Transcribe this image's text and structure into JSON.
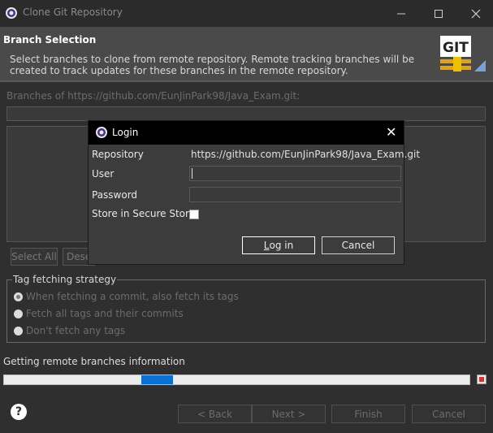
{
  "window": {
    "title": "Clone Git Repository",
    "controls": {
      "minimize": "—",
      "maximize": "☐",
      "close": "✕"
    }
  },
  "banner": {
    "title": "Branch Selection",
    "description": "Select branches to clone from remote repository. Remote tracking branches will be created to track updates for these branches in the remote repository.",
    "logo_text": "GIT"
  },
  "branches": {
    "label": "Branches of https://github.com/EunJinPark98/Java_Exam.git:",
    "filter_value": "",
    "buttons": {
      "select_all": "Select All",
      "deselect_all": "Dese"
    }
  },
  "tag_fetching": {
    "legend": "Tag fetching strategy",
    "options": [
      {
        "label": "When fetching a commit, also fetch its tags",
        "checked": true
      },
      {
        "label": "Fetch all tags and their commits",
        "checked": false
      },
      {
        "label": "Don't fetch any tags",
        "checked": false
      }
    ]
  },
  "progress": {
    "label": "Getting remote branches information",
    "indeterminate": true
  },
  "footer": {
    "help": "?",
    "back": "< Back",
    "next": "Next >",
    "finish": "Finish",
    "cancel": "Cancel"
  },
  "login_dialog": {
    "title": "Login",
    "close": "✕",
    "repository_label": "Repository",
    "repository_value": "https://github.com/EunJinPark98/Java_Exam.git",
    "user_label": "User",
    "user_value": "",
    "password_label": "Password",
    "password_value": "",
    "store_label": "Store in Secure Store",
    "store_checked": false,
    "login_button_first": "L",
    "login_button_rest": "og in",
    "cancel_button": "Cancel"
  },
  "colors": {
    "background": "#2f2f2f",
    "banner": "#4a4a4a",
    "dialog_titlebar": "#000000",
    "progress_fill": "#0a72d6",
    "stop_red": "#e03030"
  }
}
